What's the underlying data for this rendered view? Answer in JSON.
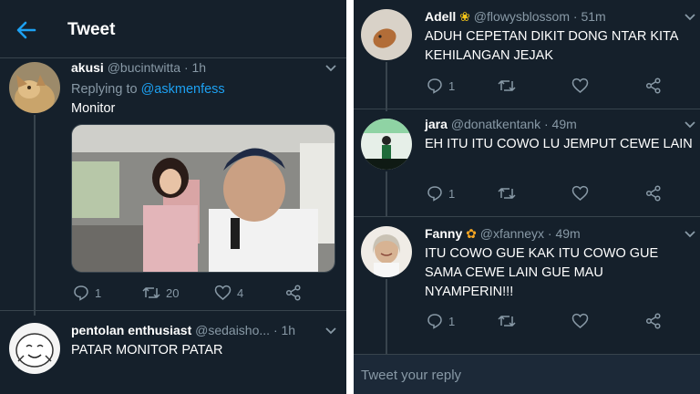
{
  "header": {
    "title": "Tweet"
  },
  "left_tweets": [
    {
      "name": "akusi",
      "handle": "@bucintwitta",
      "time": "· 1h",
      "replying_prefix": "Replying to",
      "replying_to": "@askmenfess",
      "text": "Monitor",
      "replies": "1",
      "retweets": "20",
      "likes": "4"
    },
    {
      "name": "pentolan enthusiast",
      "handle": "@sedaisho...",
      "time": "· 1h",
      "text": "PATAR MONITOR PATAR"
    }
  ],
  "right_tweets": [
    {
      "name": "Adell",
      "handle": "@flowysblossom",
      "time": "· 51m",
      "text": "ADUH CEPETAN DIKIT DONG NTAR KITA KEHILANGAN JEJAK",
      "replies": "1"
    },
    {
      "name": "jara",
      "handle": "@donatkentank",
      "time": "· 49m",
      "text": "EH ITU ITU COWO LU JEMPUT CEWE LAIN",
      "replies": "1"
    },
    {
      "name": "Fanny",
      "handle": "@xfanneyx",
      "time": "· 49m",
      "text": "ITU COWO GUE KAK ITU COWO GUE SAMA CEWE LAIN GUE MAU NYAMPERIN!!!",
      "replies": "1"
    }
  ],
  "reply_bar": {
    "placeholder": "Tweet your reply"
  },
  "colors": {
    "background": "#15202b",
    "accent": "#1da1f2",
    "muted": "#8899a6",
    "border": "#38444d"
  }
}
